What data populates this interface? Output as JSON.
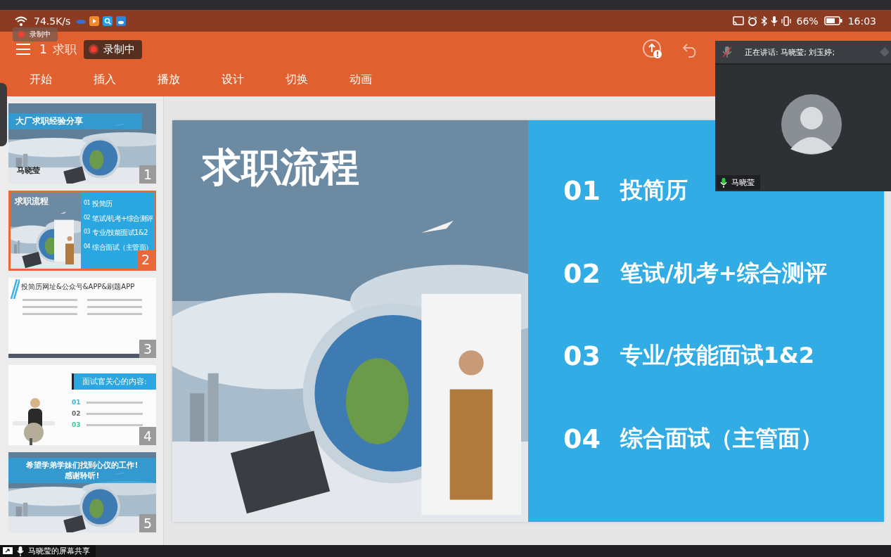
{
  "status_bar": {
    "network_speed": "74.5K/s",
    "battery": "66%",
    "time": "16:03"
  },
  "recording_badges": [
    {
      "label": "录制中"
    },
    {
      "label": "录制中"
    }
  ],
  "app_bar": {
    "slide_number": "1",
    "title": "求职"
  },
  "tabs": [
    {
      "label": "开始",
      "selected": false
    },
    {
      "label": "插入",
      "selected": false
    },
    {
      "label": "播放",
      "selected": false
    },
    {
      "label": "设计",
      "selected": false
    },
    {
      "label": "切换",
      "selected": false
    },
    {
      "label": "动画",
      "selected": false
    }
  ],
  "thumbnails": [
    {
      "kind": "title_slide",
      "number": "1",
      "selected": false,
      "title": "大厂求职经验分享",
      "subtitle": "马晓莹"
    },
    {
      "kind": "list_slide",
      "number": "2",
      "selected": true,
      "title": "求职流程",
      "items": [
        {
          "number": "01",
          "label": "投简历"
        },
        {
          "number": "02",
          "label": "笔试/机考+综合测评"
        },
        {
          "number": "03",
          "label": "专业/技能面试1&2"
        },
        {
          "number": "04",
          "label": "综合面试（主管面）"
        }
      ]
    },
    {
      "kind": "text_slide",
      "number": "3",
      "selected": false,
      "title": "投简历网址&公众号&APP&刷题APP"
    },
    {
      "kind": "content_slide",
      "number": "4",
      "selected": false,
      "title": "面试官关心的内容:",
      "numbers": [
        {
          "number": "01",
          "color": "#3ab4e6"
        },
        {
          "number": "02",
          "color": "#666666"
        },
        {
          "number": "03",
          "color": "#3cc89a"
        }
      ]
    },
    {
      "kind": "closing_slide",
      "number": "5",
      "selected": false,
      "title": "希望学弟学妹们找到心仪的工作!",
      "subtitle": "感谢聆听!"
    }
  ],
  "slide": {
    "title": "求职流程",
    "items": [
      {
        "number": "01",
        "label": "投简历"
      },
      {
        "number": "02",
        "label": "笔试/机考+综合测评"
      },
      {
        "number": "03",
        "label": "专业/技能面试1&2"
      },
      {
        "number": "04",
        "label": "综合面试（主管面）"
      }
    ]
  },
  "video_panel": {
    "speaking": "正在讲话: 马晓莹; 刘玉婷;",
    "participant": "马晓莹"
  },
  "share_bar": {
    "label": "马晓莹的屏幕共享"
  }
}
